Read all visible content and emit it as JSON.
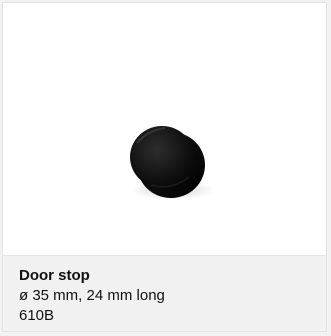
{
  "product": {
    "name": "Door stop",
    "dimensions": "ø 35 mm, 24 mm long",
    "code": "610B"
  },
  "colors": {
    "image_background": "#ffffff",
    "info_background": "#f1f1f1",
    "text": "#111111",
    "product_color": "#151515"
  },
  "icons": {
    "product_image": "black-round-door-stop"
  }
}
